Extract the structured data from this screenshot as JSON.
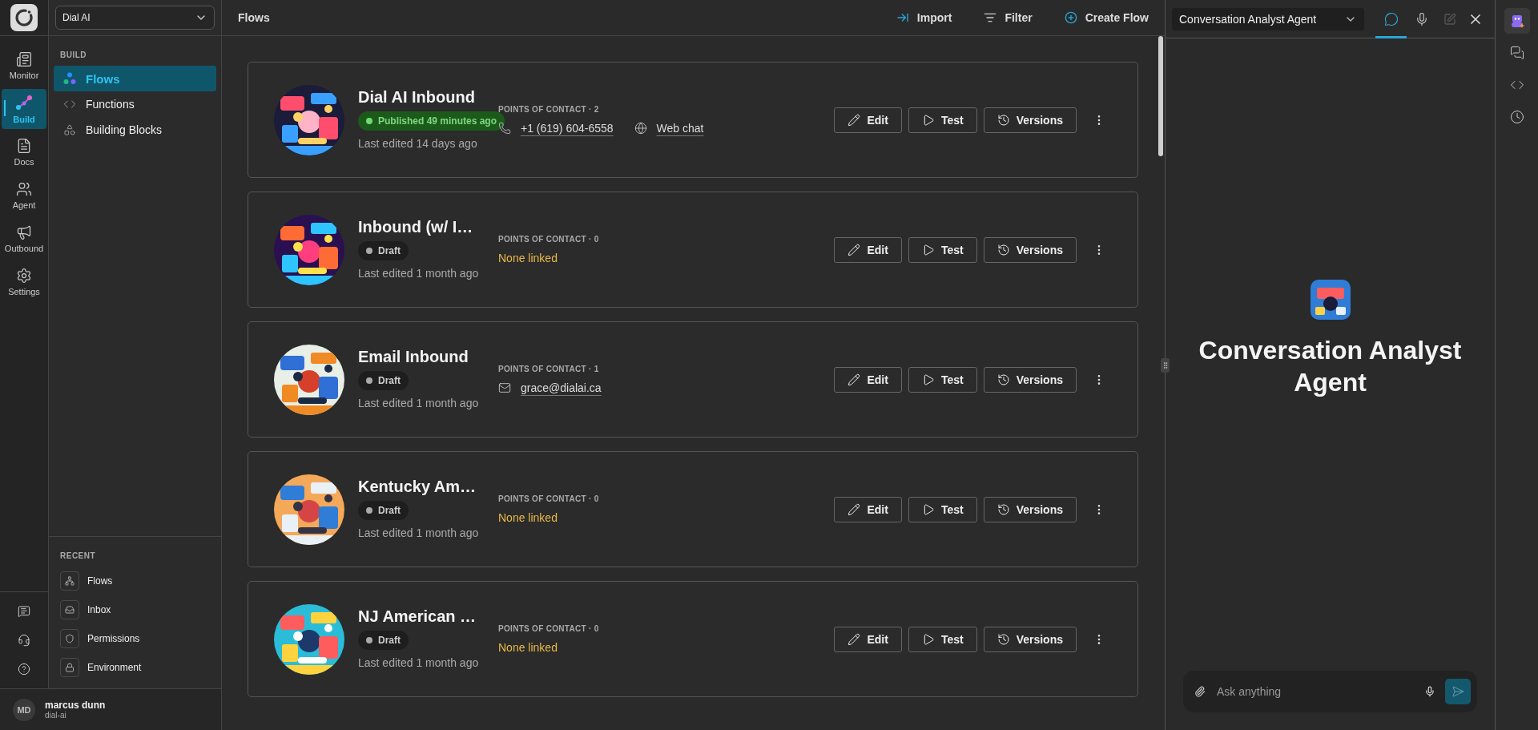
{
  "rail": {
    "items": [
      {
        "kind": "monitor",
        "label": "Monitor",
        "selected": false
      },
      {
        "kind": "build",
        "label": "Build",
        "selected": true
      },
      {
        "kind": "docs",
        "label": "Docs",
        "selected": false
      },
      {
        "kind": "agent",
        "label": "Agent",
        "selected": false
      },
      {
        "kind": "outbound",
        "label": "Outbound",
        "selected": false
      },
      {
        "kind": "settings",
        "label": "Settings",
        "selected": false
      }
    ],
    "bottom_icons": [
      {
        "kind": "chat"
      },
      {
        "kind": "support"
      },
      {
        "kind": "help"
      }
    ]
  },
  "workspace": {
    "value": "Dial AI"
  },
  "sidebar": {
    "section": "BUILD",
    "items": [
      {
        "kind": "flows",
        "label": "Flows",
        "selected": true
      },
      {
        "kind": "functions",
        "label": "Functions",
        "selected": false
      },
      {
        "kind": "blocks",
        "label": "Building Blocks",
        "selected": false
      }
    ],
    "recent_title": "RECENT",
    "recent": [
      {
        "kind": "flows",
        "label": "Flows"
      },
      {
        "kind": "inbox",
        "label": "Inbox"
      },
      {
        "kind": "permissions",
        "label": "Permissions"
      },
      {
        "kind": "environment",
        "label": "Environment"
      }
    ]
  },
  "user": {
    "initials": "MD",
    "name": "marcus dunn",
    "handle": "dial-ai"
  },
  "header": {
    "title": "Flows",
    "actions": [
      {
        "kind": "import",
        "label": "Import"
      },
      {
        "kind": "filter",
        "label": "Filter"
      },
      {
        "kind": "create",
        "label": "Create Flow"
      }
    ]
  },
  "flows": [
    {
      "title": "Dial AI Inbound",
      "status": {
        "kind": "published",
        "label": "Published 49 minutes ago"
      },
      "edited": "Last edited 14 days ago",
      "contacts_label": "POINTS OF CONTACT · 2",
      "contacts": [
        {
          "kind": "phone",
          "text": "+1 (619) 604-6558"
        },
        {
          "kind": "web",
          "text": "Web chat"
        }
      ],
      "buttons": [
        "Edit",
        "Test",
        "Versions"
      ]
    },
    {
      "title": "Inbound (w/ I…",
      "status": {
        "kind": "draft",
        "label": "Draft"
      },
      "edited": "Last edited 1 month ago",
      "contacts_label": "POINTS OF CONTACT · 0",
      "empty_note": "None linked",
      "buttons": [
        "Edit",
        "Test",
        "Versions"
      ]
    },
    {
      "title": "Email Inbound",
      "status": {
        "kind": "draft",
        "label": "Draft"
      },
      "edited": "Last edited 1 month ago",
      "contacts_label": "POINTS OF CONTACT · 1",
      "contacts": [
        {
          "kind": "email",
          "text": "grace@dialai.ca"
        }
      ],
      "buttons": [
        "Edit",
        "Test",
        "Versions"
      ]
    },
    {
      "title": "Kentucky Am…",
      "status": {
        "kind": "draft",
        "label": "Draft"
      },
      "edited": "Last edited 1 month ago",
      "contacts_label": "POINTS OF CONTACT · 0",
      "empty_note": "None linked",
      "buttons": [
        "Edit",
        "Test",
        "Versions"
      ]
    },
    {
      "title": "NJ American …",
      "status": {
        "kind": "draft",
        "label": "Draft"
      },
      "edited": "Last edited 1 month ago",
      "contacts_label": "POINTS OF CONTACT · 0",
      "empty_note": "None linked",
      "buttons": [
        "Edit",
        "Test",
        "Versions"
      ]
    }
  ],
  "assistant": {
    "agent_select": "Conversation Analyst Agent",
    "tabs": [
      {
        "kind": "chat",
        "selected": true
      },
      {
        "kind": "voice",
        "selected": false
      }
    ],
    "new_chat": {
      "disabled": true
    },
    "agent_name": "Conversation Analyst Agent",
    "input": {
      "placeholder": "Ask anything"
    }
  },
  "right_rail": [
    {
      "kind": "agent",
      "selected": true
    },
    {
      "kind": "conversations",
      "selected": false
    },
    {
      "kind": "code",
      "selected": false
    },
    {
      "kind": "history",
      "selected": false
    }
  ]
}
